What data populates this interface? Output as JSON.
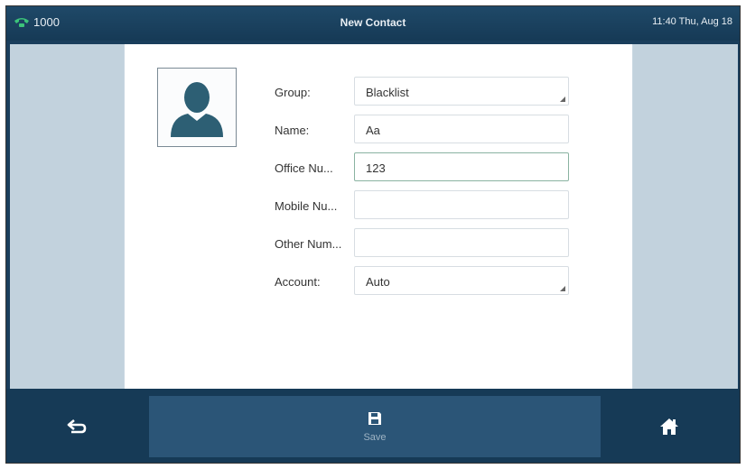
{
  "status": {
    "line": "1000",
    "title": "New Contact",
    "time": "11:40 Thu, Aug 18"
  },
  "form": {
    "group": {
      "label": "Group:",
      "value": "Blacklist"
    },
    "name": {
      "label": "Name:",
      "value": "Aa"
    },
    "office": {
      "label": "Office Nu...",
      "value": "123"
    },
    "mobile": {
      "label": "Mobile Nu...",
      "value": ""
    },
    "other": {
      "label": "Other Num...",
      "value": ""
    },
    "account": {
      "label": "Account:",
      "value": "Auto"
    }
  },
  "softkeys": {
    "save": "Save"
  },
  "icons": {
    "line": "phone-icon",
    "avatar": "contact-avatar-icon",
    "back": "back-icon",
    "save": "floppy-disk-icon",
    "home": "home-icon"
  },
  "colors": {
    "status_bar": "#1f4968",
    "bottom_bar": "#163a56",
    "save_key": "#2b5577",
    "avatar": "#2d5f74",
    "line_green": "#3cc47a"
  }
}
